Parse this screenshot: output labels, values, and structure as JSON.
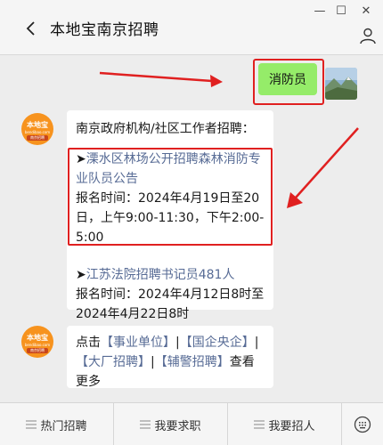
{
  "window": {
    "title": "本地宝南京招聘",
    "controls": {
      "minimize": "—",
      "maximize": "☐",
      "close": "✕"
    }
  },
  "messages": {
    "sent": {
      "text": "消防员"
    },
    "reply1": {
      "intro": "南京政府机构/社区工作者招聘：",
      "item1_marker": "➤",
      "item1_link": "溧水区林场公开招聘森林消防专业队员公告",
      "item1_detail": "报名时间：2024年4月19日至20日，上午9:00-11:30，下午2:00-5:00",
      "item2_marker": "➤",
      "item2_link": "江苏法院招聘书记员481人",
      "item2_detail": "报名时间：2024年4月12日8时至2024年4月22日8时"
    },
    "reply2": {
      "prefix": "点击",
      "link1": "【事业单位】",
      "sep1": "|",
      "link2": "【国企央企】",
      "sep2": "|",
      "link3": "【大厂招聘】",
      "sep3": "|",
      "link4": "【辅警招聘】",
      "suffix": "查看更多"
    }
  },
  "avatar": {
    "logo_top": "本地宝",
    "logo_mid": "bendibao.com",
    "logo_bottom": "南京招聘"
  },
  "menu": {
    "tab1": "热门招聘",
    "tab2": "我要求职",
    "tab3": "我要招人"
  },
  "colors": {
    "accent_red": "#e02020",
    "sent_bubble": "#95ec69",
    "link": "#576b95",
    "logo_orange": "#f7931e"
  }
}
